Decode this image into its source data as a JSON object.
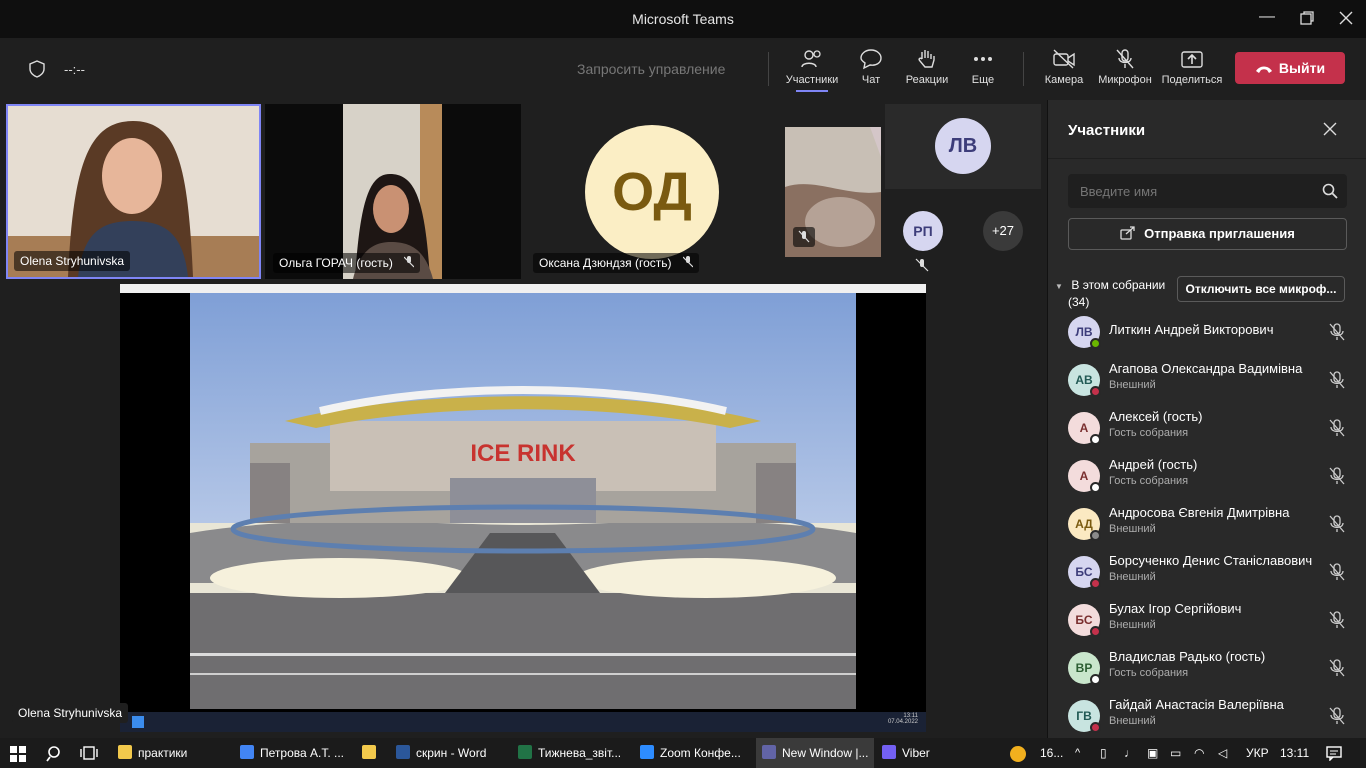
{
  "window": {
    "title": "Microsoft Teams"
  },
  "meeting": {
    "timer": "--:--",
    "request_control": "Запросить управление",
    "toolbar": {
      "participants": "Участники",
      "chat": "Чат",
      "reactions": "Реакции",
      "more": "Еще",
      "camera": "Камера",
      "mic": "Микрофон",
      "share": "Поделиться",
      "leave": "Выйти"
    },
    "tiles": [
      {
        "name": "Olena Stryhunivska"
      },
      {
        "name": "Ольга ГОРАЧ (гость)"
      },
      {
        "name": "Оксана Дзюндзя (гость)",
        "initials": "ОД"
      }
    ],
    "small_tiles": {
      "lv": "ЛВ",
      "rp": "РП",
      "more": "+27"
    },
    "presenter_label": "Olena Stryhunivska",
    "shared_screen": {
      "sign": "ICE RINK",
      "clock_time": "13:11",
      "clock_date": "07.04.2022"
    }
  },
  "panel": {
    "title": "Участники",
    "search_placeholder": "Введите имя",
    "invite": "Отправка приглашения",
    "section_label": "В этом собрании",
    "section_count": "(34)",
    "mute_all": "Отключить все микроф...",
    "participants": [
      {
        "initials": "ЛВ",
        "name": "Литкин Андрей Викторович",
        "sub": "",
        "avatar_color": "#d6d6f0",
        "text_color": "#3d3d7a",
        "status_color": "#6bb700"
      },
      {
        "initials": "АВ",
        "name": "Агапова Олександра Вадимівна",
        "sub": "Внешний",
        "avatar_color": "#c8e4e0",
        "text_color": "#225a55",
        "status_color": "#c4314b"
      },
      {
        "initials": "А",
        "name": "Алексей (гость)",
        "sub": "Гость собрания",
        "avatar_color": "#f3dcdc",
        "text_color": "#7a2f2f",
        "status_color": "#ffffff"
      },
      {
        "initials": "А",
        "name": "Андрей (гость)",
        "sub": "Гость собрания",
        "avatar_color": "#f3dcdc",
        "text_color": "#7a2f2f",
        "status_color": "#ffffff"
      },
      {
        "initials": "АД",
        "name": "Андросова Євгенія Дмитрівна",
        "sub": "Внешний",
        "avatar_color": "#fbe9c2",
        "text_color": "#7a5a10",
        "status_color": "#8a8a8a"
      },
      {
        "initials": "БС",
        "name": "Борсученко Денис Станіславович",
        "sub": "Внешний",
        "avatar_color": "#d6d6f0",
        "text_color": "#3d3d7a",
        "status_color": "#c4314b"
      },
      {
        "initials": "БС",
        "name": "Булах Ігор Сергійович",
        "sub": "Внешний",
        "avatar_color": "#f3dcdc",
        "text_color": "#7a2f2f",
        "status_color": "#c4314b"
      },
      {
        "initials": "ВР",
        "name": "Владислав Радько (гость)",
        "sub": "Гость собрания",
        "avatar_color": "#c9e6cc",
        "text_color": "#2c5e33",
        "status_color": "#ffffff"
      },
      {
        "initials": "ГВ",
        "name": "Гайдай Анастасія Валеріївна",
        "sub": "Внешний",
        "avatar_color": "#c8e4e0",
        "text_color": "#225a55",
        "status_color": "#c4314b"
      }
    ]
  },
  "taskbar": {
    "items": [
      {
        "label": "практики",
        "color": "#f2c94c"
      },
      {
        "label": "Петрова А.Т. ...",
        "color": "#4285f4"
      },
      {
        "label": "",
        "color": "#f2c94c"
      },
      {
        "label": "скрин - Word",
        "color": "#2b579a"
      },
      {
        "label": "Тижнева_звіт...",
        "color": "#217346"
      },
      {
        "label": "Zoom Конфе...",
        "color": "#2d8cff"
      },
      {
        "label": "New Window |...",
        "color": "#6264a7"
      },
      {
        "label": "Viber",
        "color": "#7360f2"
      }
    ],
    "weather": "16...",
    "lang": "УКР",
    "time": "13:11"
  }
}
